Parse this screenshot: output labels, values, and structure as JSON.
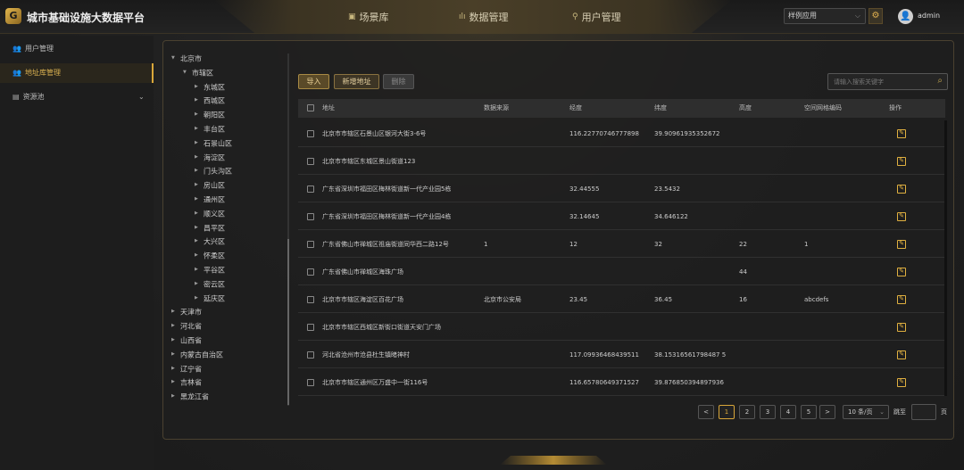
{
  "header": {
    "logo_glyph": "G",
    "title": "城市基础设施大数据平台",
    "nav": [
      {
        "icon": "▣",
        "label": "场景库"
      },
      {
        "icon": "ılı",
        "label": "数据管理"
      },
      {
        "icon": "⚲",
        "label": "用户管理"
      }
    ],
    "app_select": "样例应用",
    "username": "admin"
  },
  "sidebar": {
    "items": [
      {
        "icon": "👥",
        "label": "用户管理",
        "active": false
      },
      {
        "icon": "👥",
        "label": "地址库管理",
        "active": true
      },
      {
        "icon": "▤",
        "label": "资源池",
        "active": false,
        "expandable": true
      }
    ]
  },
  "tree": [
    {
      "label": "北京市",
      "level": 0,
      "expanded": true
    },
    {
      "label": "市辖区",
      "level": 1,
      "expanded": true
    },
    {
      "label": "东城区",
      "level": 2
    },
    {
      "label": "西城区",
      "level": 2
    },
    {
      "label": "朝阳区",
      "level": 2
    },
    {
      "label": "丰台区",
      "level": 2
    },
    {
      "label": "石景山区",
      "level": 2
    },
    {
      "label": "海淀区",
      "level": 2
    },
    {
      "label": "门头沟区",
      "level": 2
    },
    {
      "label": "房山区",
      "level": 2
    },
    {
      "label": "通州区",
      "level": 2
    },
    {
      "label": "顺义区",
      "level": 2
    },
    {
      "label": "昌平区",
      "level": 2
    },
    {
      "label": "大兴区",
      "level": 2
    },
    {
      "label": "怀柔区",
      "level": 2
    },
    {
      "label": "平谷区",
      "level": 2
    },
    {
      "label": "密云区",
      "level": 2
    },
    {
      "label": "延庆区",
      "level": 2
    },
    {
      "label": "天津市",
      "level": 0
    },
    {
      "label": "河北省",
      "level": 0
    },
    {
      "label": "山西省",
      "level": 0
    },
    {
      "label": "内蒙古自治区",
      "level": 0
    },
    {
      "label": "辽宁省",
      "level": 0
    },
    {
      "label": "吉林省",
      "level": 0
    },
    {
      "label": "黑龙江省",
      "level": 0
    }
  ],
  "toolbar": {
    "import_label": "导入",
    "add_label": "新增地址",
    "delete_label": "删除",
    "search_placeholder": "请输入搜索关键字"
  },
  "table": {
    "columns": [
      "地址",
      "数据来源",
      "经度",
      "纬度",
      "高度",
      "空间网格编码",
      "操作"
    ],
    "rows": [
      [
        "北京市市辖区石景山区银河大街3-6号",
        "",
        "116.22770746777898",
        "39.90961935352672",
        "",
        ""
      ],
      [
        "北京市市辖区东城区景山街道123",
        "",
        "",
        "",
        "",
        ""
      ],
      [
        "广东省深圳市福田区梅林街道新一代产业园5栋",
        "",
        "32.44555",
        "23.5432",
        "",
        ""
      ],
      [
        "广东省深圳市福田区梅林街道新一代产业园4栋",
        "",
        "32.14645",
        "34.646122",
        "",
        ""
      ],
      [
        "广东省佛山市禅城区祖庙街道同华西二路12号",
        "1",
        "12",
        "32",
        "22",
        "1"
      ],
      [
        "广东省佛山市禅城区海珠广场",
        "",
        "",
        "",
        "44",
        ""
      ],
      [
        "北京市市辖区海淀区百花广场",
        "北京市公安局",
        "23.45",
        "36.45",
        "16",
        "abcdefs"
      ],
      [
        "北京市市辖区西城区新街口街道天安门广场",
        "",
        "",
        "",
        "",
        ""
      ],
      [
        "河北省沧州市沧县杜生镇睹神村",
        "",
        "117.09936468439511",
        "38.15316561798487 5",
        "",
        ""
      ],
      [
        "北京市市辖区通州区万盛中一街116号",
        "",
        "116.65780649371527",
        "39.876850394897936",
        "",
        ""
      ]
    ]
  },
  "pagination": {
    "prev": "<",
    "pages": [
      "1",
      "2",
      "3",
      "4",
      "5"
    ],
    "current": "1",
    "next": ">",
    "page_size": "10 条/页",
    "goto_label": "跳至",
    "page_suffix": "页"
  }
}
